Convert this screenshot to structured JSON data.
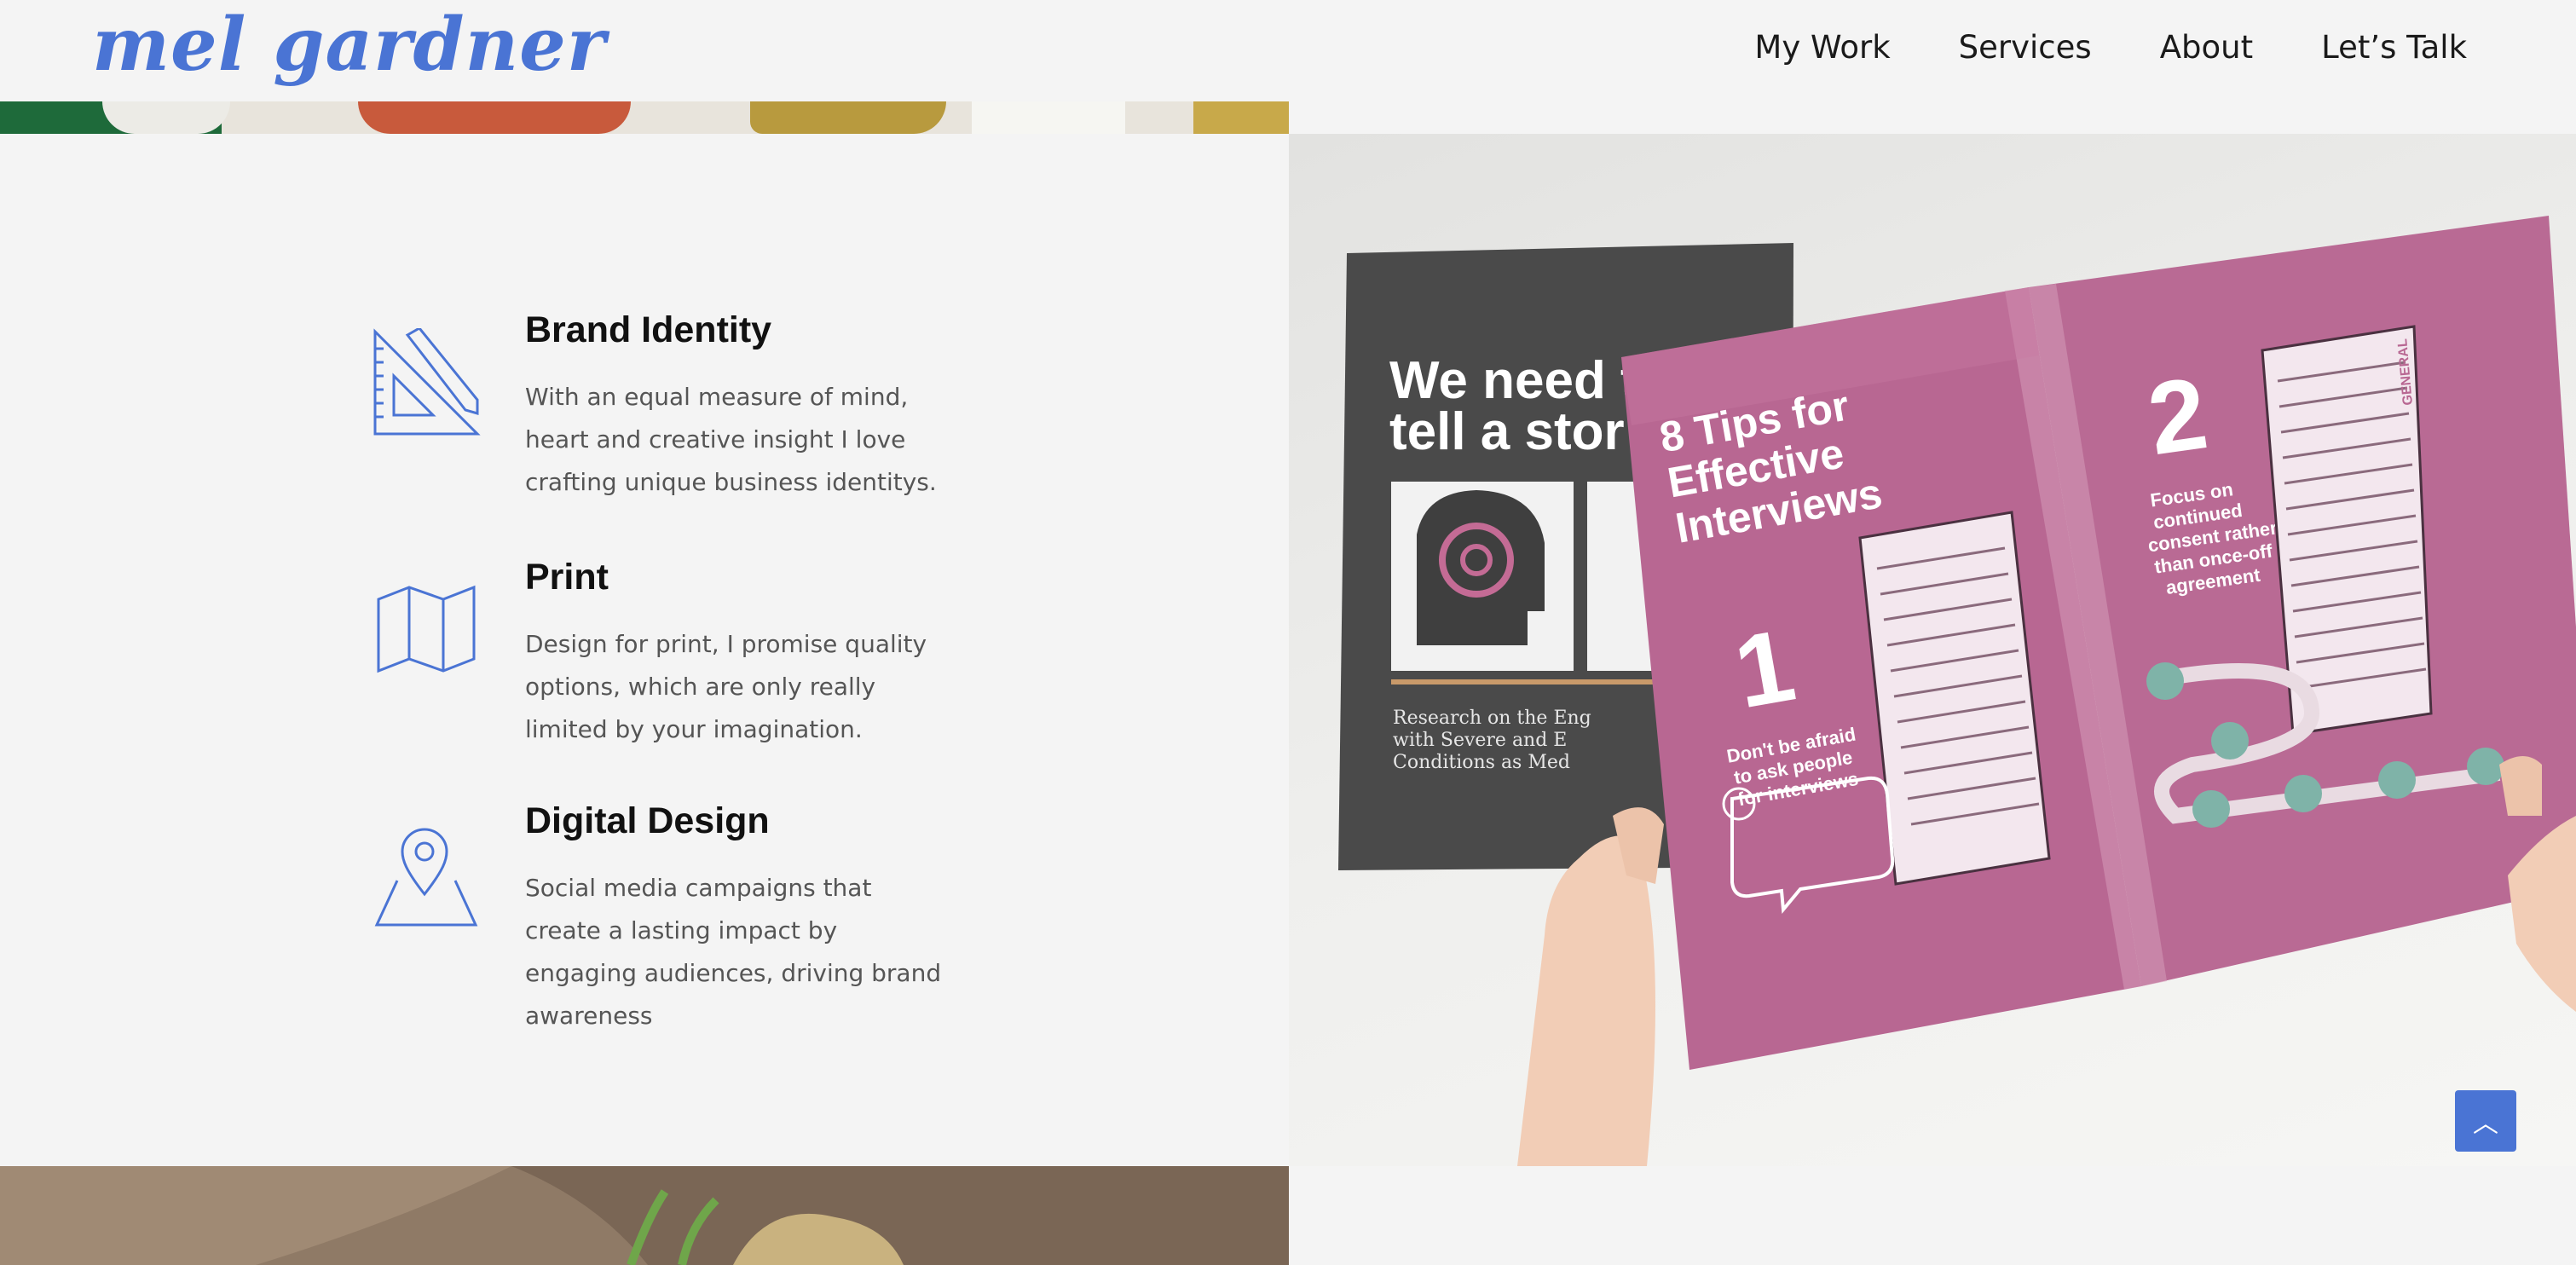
{
  "header": {
    "logo": "mel gardner",
    "nav": [
      "My Work",
      "Services",
      "About",
      "Let’s Talk"
    ]
  },
  "services": [
    {
      "title": "Brand Identity",
      "description": "With an equal measure of mind, heart and creative insight I love crafting unique business identitys.",
      "icon": "ruler-triangle-icon"
    },
    {
      "title": "Print",
      "description": "Design for print, I promise quality options, which are only really limited by your imagination.",
      "icon": "map-icon"
    },
    {
      "title": "Digital Design",
      "description": "Social media campaigns that create a lasting impact by engaging audiences, driving brand awareness",
      "icon": "location-pin-icon"
    }
  ],
  "hero": {
    "dark_cover_title_1": "We need t",
    "dark_cover_title_2": "tell a stor",
    "dark_cover_caption_1": "Research on the Eng",
    "dark_cover_caption_2": "with Severe and E",
    "dark_cover_caption_3": "Conditions as Med",
    "magazine_heading_1": "8 Tips for",
    "magazine_heading_2": "Effective",
    "magazine_heading_3": "Interviews",
    "tip_1_number": "1",
    "tip_1_text_1": "Don't be afraid",
    "tip_1_text_2": "to ask people",
    "tip_1_text_3": "for interviews",
    "tip_2_number": "2",
    "tip_2_text_1": "Focus on",
    "tip_2_text_2": "continued",
    "tip_2_text_3": "consent rather",
    "tip_2_text_4": "than once-off",
    "tip_2_text_5": "agreement",
    "tag": "GENERAL"
  },
  "colors": {
    "accent": "#4a74d4",
    "magazine_pink": "#b86792",
    "dark_cover": "#4a4a4a"
  },
  "scroll_top": {
    "icon": "chevron-up-icon",
    "glyph": "︿"
  }
}
